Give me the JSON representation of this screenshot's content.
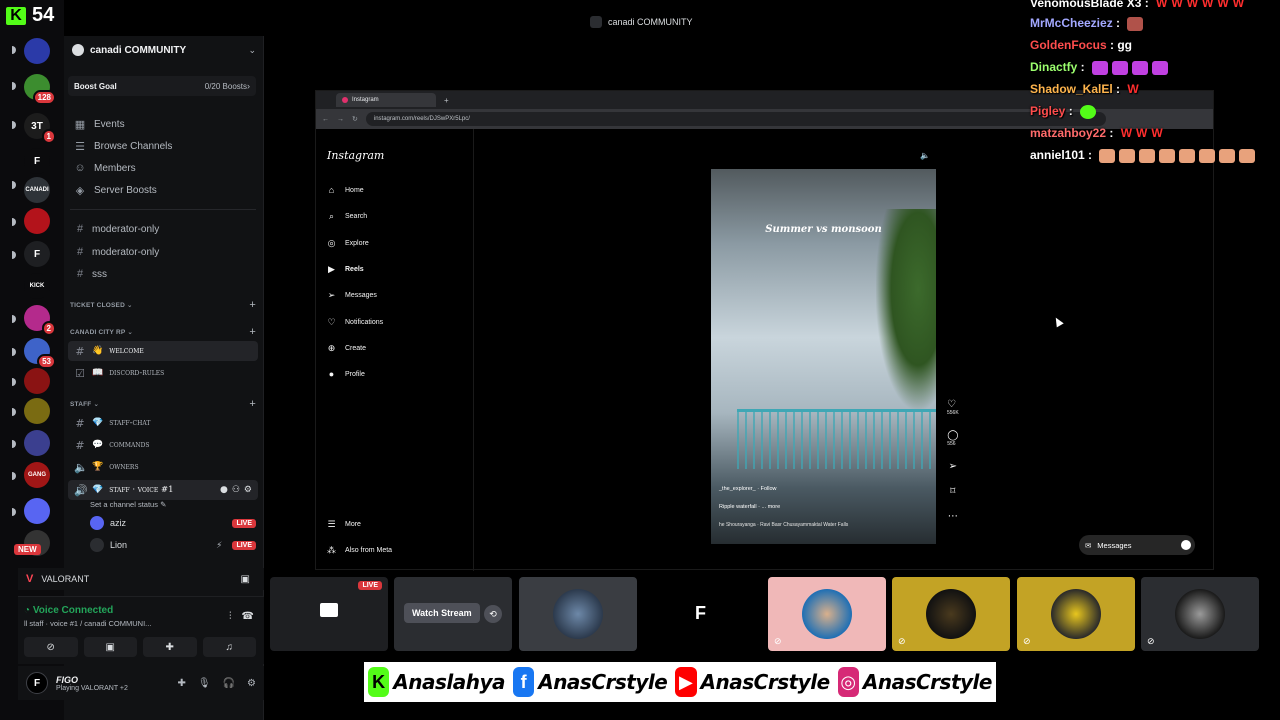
{
  "kick": {
    "logo": "K",
    "count": "54"
  },
  "rail": {
    "servers": [
      {
        "name": "server-1",
        "color": "#2b3aa8"
      },
      {
        "name": "server-2",
        "color": "#3c8d2f",
        "badge": "128"
      },
      {
        "name": "server-3",
        "color": "#1c1c1c",
        "badge": "1",
        "glyph": "3T"
      },
      {
        "name": "server-4",
        "color": "#0b0b0d",
        "glyph": "F"
      },
      {
        "name": "server-5",
        "color": "#2e3338",
        "glyph": "CANADI"
      },
      {
        "name": "server-6",
        "color": "#b3131b"
      },
      {
        "name": "server-7",
        "color": "#1e1f22",
        "glyph": "F"
      },
      {
        "name": "server-8",
        "color": "#0b0b0d",
        "glyph": "KICK"
      },
      {
        "name": "server-9",
        "color": "#b42a8c",
        "badge": "2"
      },
      {
        "name": "server-10",
        "color": "#3e63c9",
        "badge": "53"
      },
      {
        "name": "server-11",
        "color": "#8a1313"
      },
      {
        "name": "server-12",
        "color": "#7a6b12"
      },
      {
        "name": "server-13",
        "color": "#3b3f8f"
      },
      {
        "name": "server-14",
        "color": "#a11616",
        "glyph": "GANG"
      },
      {
        "name": "server-15",
        "color": "#5865f2"
      },
      {
        "name": "server-16",
        "color": "#333",
        "new": "NEW"
      }
    ]
  },
  "window_title": "canadi COMMUNITY",
  "guild": {
    "name": "canadi COMMUNITY",
    "boost_label": "Boost Goal",
    "boost_value": "0/20 Boosts",
    "nav": [
      "Events",
      "Browse Channels",
      "Members",
      "Server Boosts"
    ],
    "channels_top": [
      "moderator-only",
      "moderator-only",
      "sss"
    ],
    "cat_ticket": "TICKET CLOSED",
    "cat_city": "CANADI CITY RP",
    "ch_welcome": "welcome",
    "ch_rules": "discord-rules",
    "cat_staff": "STAFF",
    "ch_staff_chat": "staff-chat",
    "ch_commands": "commands",
    "ch_owners": "owners",
    "ch_voice": "staff · voice #1",
    "voice_status": "Set a channel status",
    "voice_users": [
      {
        "name": "aziz",
        "live": "LIVE"
      },
      {
        "name": "Lion",
        "live": "LIVE"
      }
    ]
  },
  "game": {
    "name": "VALORANT"
  },
  "voice": {
    "status": "Voice Connected",
    "sub": "ll staff · voice #1 / canadi COMMUNI..."
  },
  "user": {
    "name": "FIGO",
    "activity": "Playing VALORANT +2",
    "initial": "F"
  },
  "browser": {
    "tab_title": "Instagram",
    "url": "instagram.com/reels/DJSwPXr5Lpc/"
  },
  "instagram": {
    "logo": "Instagram",
    "nav": [
      {
        "label": "Home",
        "icon": "home-icon"
      },
      {
        "label": "Search",
        "icon": "search-icon"
      },
      {
        "label": "Explore",
        "icon": "explore-icon"
      },
      {
        "label": "Reels",
        "icon": "reels-icon",
        "active": true
      },
      {
        "label": "Messages",
        "icon": "send-icon"
      },
      {
        "label": "Notifications",
        "icon": "heart-icon"
      },
      {
        "label": "Create",
        "icon": "plus-icon"
      },
      {
        "label": "Profile",
        "icon": "profile-icon"
      }
    ],
    "more": "More",
    "meta": "Also from Meta",
    "reel": {
      "caption": "Summer vs monsoon",
      "user": "_the_explorer_ · Follow",
      "desc": "Ripple waterfall · ... more",
      "music": "he Shourayanga · Ravi Basr   Chusayammaktal Water Falls",
      "likes": "556K",
      "comments": "556"
    },
    "messages_pill": "Messages"
  },
  "chat": [
    {
      "user": "VenomousBlade X3",
      "color": "#ffffff",
      "msg": "",
      "w": 6
    },
    {
      "user": "MrMcCheeziez",
      "color": "#a3a8ff",
      "msg": "",
      "emote": true
    },
    {
      "user": "GoldenFocus",
      "color": "#ff4d4d",
      "msg": "gg"
    },
    {
      "user": "Dinactfy",
      "color": "#9cff6e",
      "msg": "",
      "emotes": 4,
      "emote_color": "#c040e0"
    },
    {
      "user": "Shadow_KalEl",
      "color": "#ffb54d",
      "msg": "",
      "w": 1
    },
    {
      "user": "Pigley",
      "color": "#ff4d4d",
      "msg": "",
      "gg_emote": true
    },
    {
      "user": "matzahboy22",
      "color": "#ff6b6b",
      "msg": "",
      "w": 3
    },
    {
      "user": "anniel101",
      "color": "#ffffff",
      "msg": "",
      "emotes": 8,
      "emote_color": "#e8a27c"
    }
  ],
  "tiles": {
    "live": "LIVE",
    "watch": "Watch Stream",
    "f_glyph": "F"
  },
  "socials": [
    {
      "icon": "kick-icon",
      "glyph": "K",
      "color": "#53fc18",
      "handle": "Anaslahya"
    },
    {
      "icon": "facebook-icon",
      "glyph": "f",
      "color": "#1877f2",
      "handle": "AnasCrstyle"
    },
    {
      "icon": "youtube-icon",
      "glyph": "▶",
      "color": "#ff0000",
      "handle": "AnasCrstyle"
    },
    {
      "icon": "instagram-icon",
      "glyph": "◎",
      "color": "#d62976",
      "handle": "AnasCrstyle"
    }
  ]
}
